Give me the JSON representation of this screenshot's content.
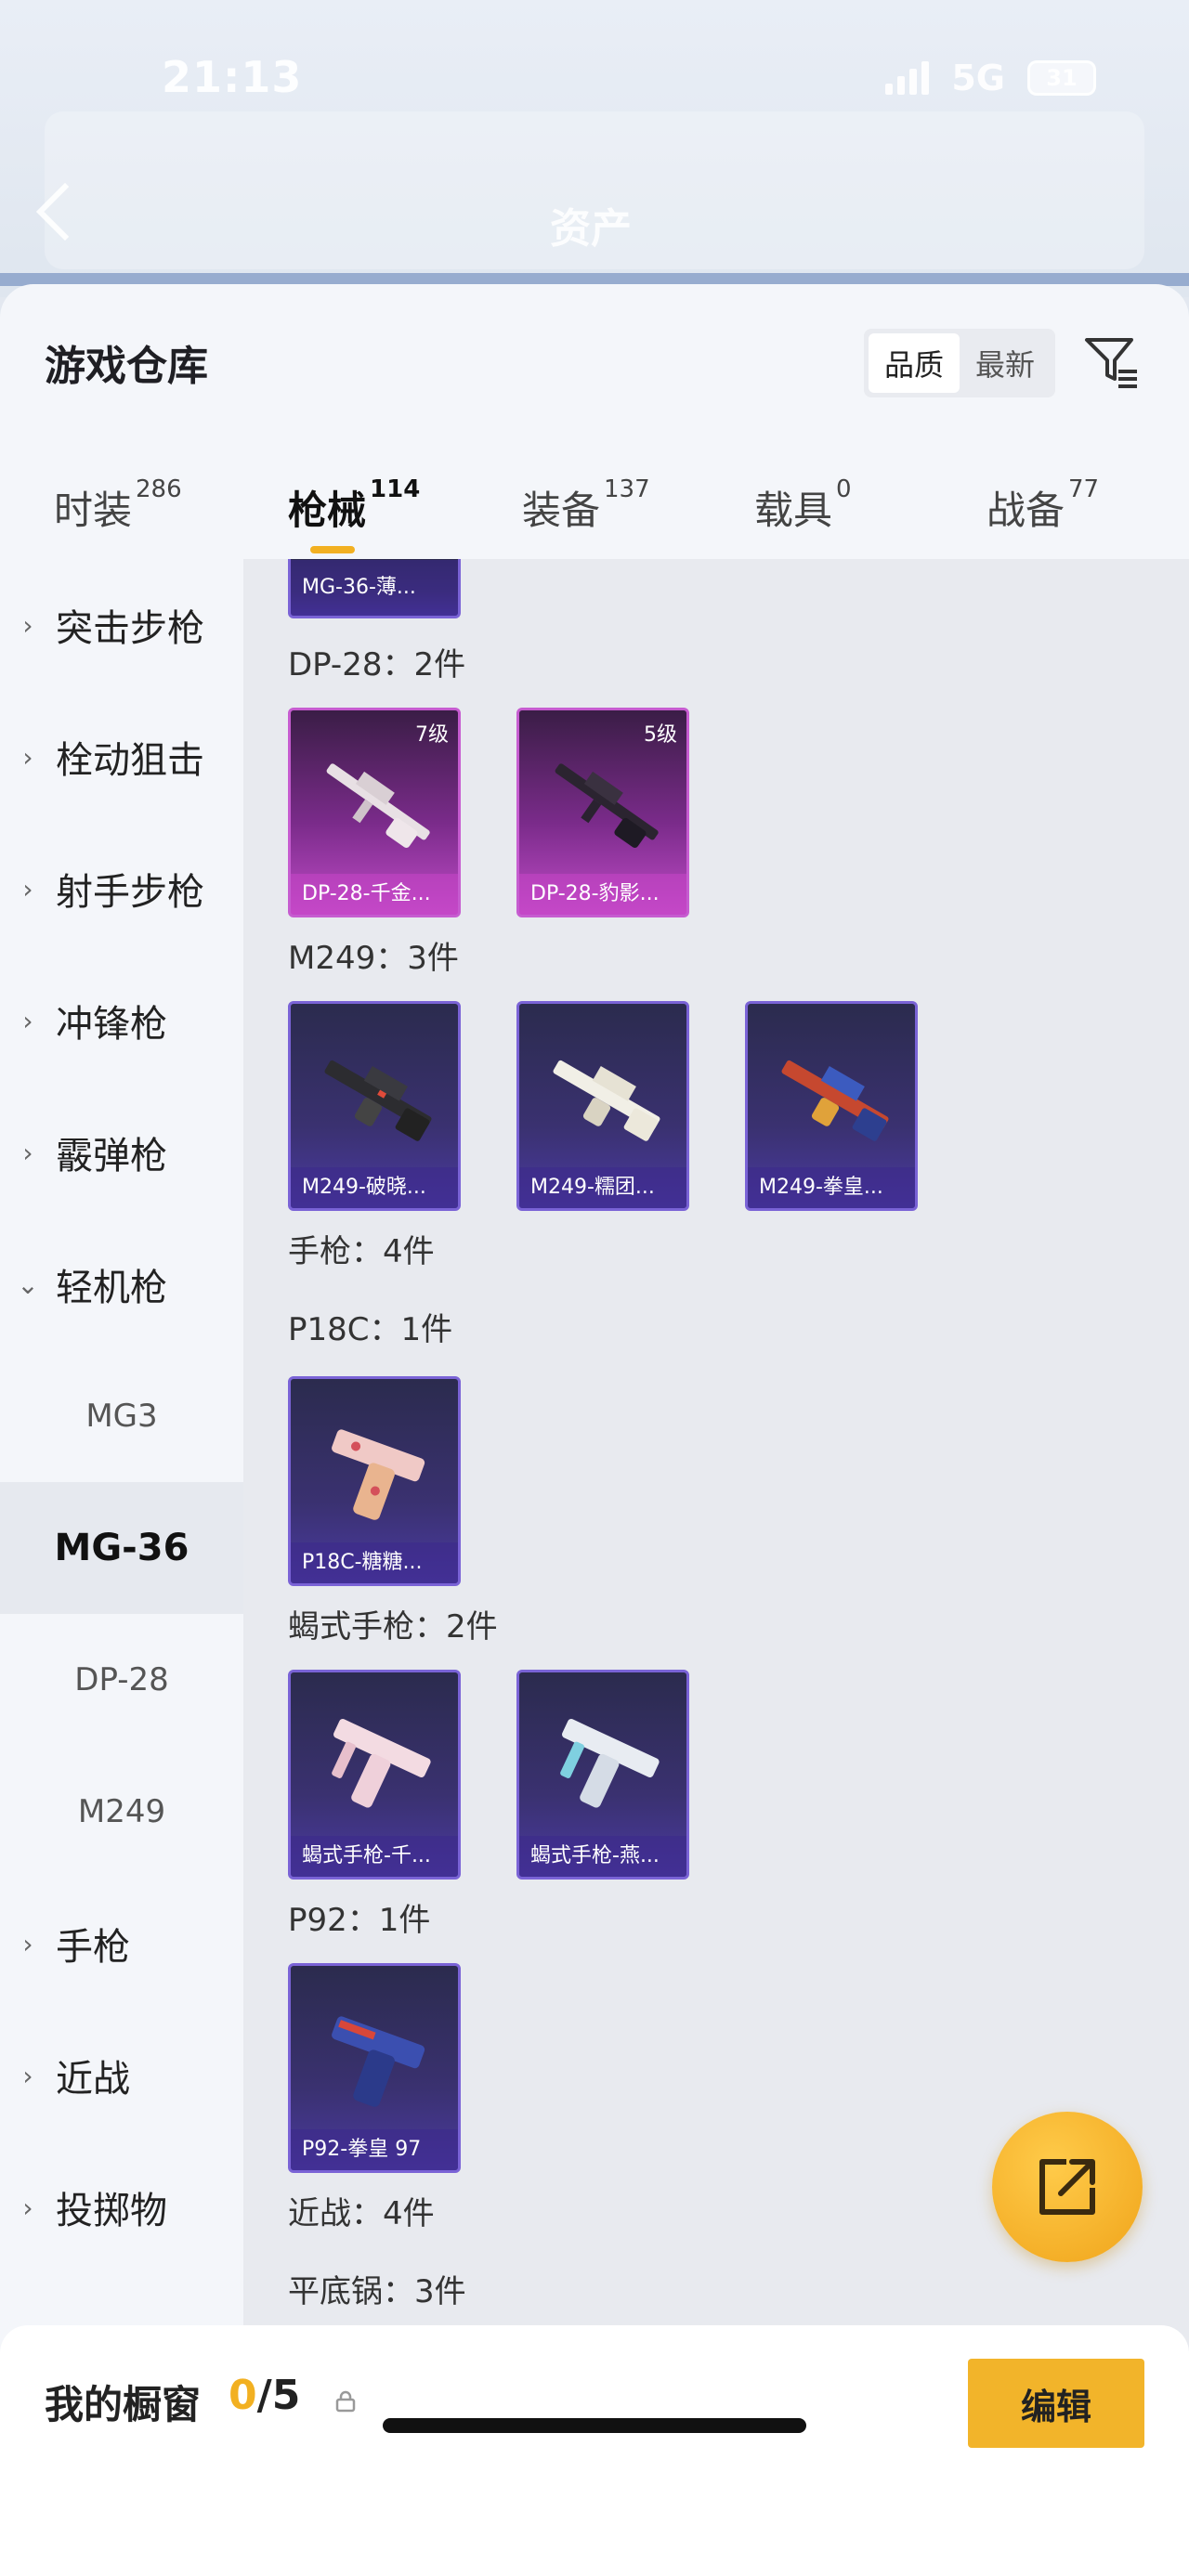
{
  "status_bar": {
    "time": "21:13",
    "network": "5G",
    "battery": "31"
  },
  "header": {
    "title": "资产"
  },
  "warehouse": {
    "title": "游戏仓库",
    "sort": {
      "options": [
        "品质",
        "最新"
      ],
      "selected": "品质"
    },
    "filter_icon": "filter-icon"
  },
  "tabs": [
    {
      "label": "时装",
      "count": "286"
    },
    {
      "label": "枪械",
      "count": "114",
      "active": true
    },
    {
      "label": "装备",
      "count": "137"
    },
    {
      "label": "载具",
      "count": "0"
    },
    {
      "label": "战备",
      "count": "77"
    }
  ],
  "sidebar": {
    "items": [
      {
        "label": "突击步枪",
        "type": "category"
      },
      {
        "label": "栓动狙击",
        "type": "category"
      },
      {
        "label": "射手步枪",
        "type": "category"
      },
      {
        "label": "冲锋枪",
        "type": "category"
      },
      {
        "label": "霰弹枪",
        "type": "category"
      },
      {
        "label": "轻机枪",
        "type": "category-expanded"
      },
      {
        "label": "MG3",
        "type": "sub"
      },
      {
        "label": "MG-36",
        "type": "sub-selected"
      },
      {
        "label": "DP-28",
        "type": "sub"
      },
      {
        "label": "M249",
        "type": "sub"
      },
      {
        "label": "手枪",
        "type": "category"
      },
      {
        "label": "近战",
        "type": "category"
      },
      {
        "label": "投掷物",
        "type": "category"
      }
    ]
  },
  "content": {
    "partial_card": {
      "name": "MG-36-薄..."
    },
    "groups": [
      {
        "label": "DP-28：2件",
        "cards": [
          {
            "name": "DP-28-千金...",
            "level": "7级",
            "tier": "purple",
            "gun": "lmg-white"
          },
          {
            "name": "DP-28-豹影...",
            "level": "5级",
            "tier": "purple",
            "gun": "lmg-dark"
          }
        ]
      },
      {
        "label": "M249：3件",
        "cards": [
          {
            "name": "M249-破晓...",
            "tier": "blue",
            "gun": "m249-dark"
          },
          {
            "name": "M249-糯团...",
            "tier": "blue",
            "gun": "m249-white"
          },
          {
            "name": "M249-拳皇...",
            "tier": "blue",
            "gun": "m249-red"
          }
        ]
      },
      {
        "label": "手枪：4件",
        "cards": []
      },
      {
        "label": "P18C：1件",
        "cards": [
          {
            "name": "P18C-糖糖...",
            "tier": "blue",
            "gun": "pistol-pink"
          }
        ]
      },
      {
        "label": "蝎式手枪：2件",
        "cards": [
          {
            "name": "蝎式手枪-千...",
            "tier": "blue",
            "gun": "smg-pink"
          },
          {
            "name": "蝎式手枪-燕...",
            "tier": "blue",
            "gun": "smg-white"
          }
        ]
      },
      {
        "label": "P92：1件",
        "cards": [
          {
            "name": "P92-拳皇 97",
            "tier": "blue",
            "gun": "pistol-blue"
          }
        ]
      },
      {
        "label": "近战：4件",
        "cards": []
      },
      {
        "label": "平底锅：3件",
        "cards": []
      }
    ]
  },
  "share_button": {
    "icon": "share-icon"
  },
  "showcase": {
    "label": "我的橱窗",
    "used": "0",
    "total": "/5",
    "edit_label": "编辑"
  }
}
